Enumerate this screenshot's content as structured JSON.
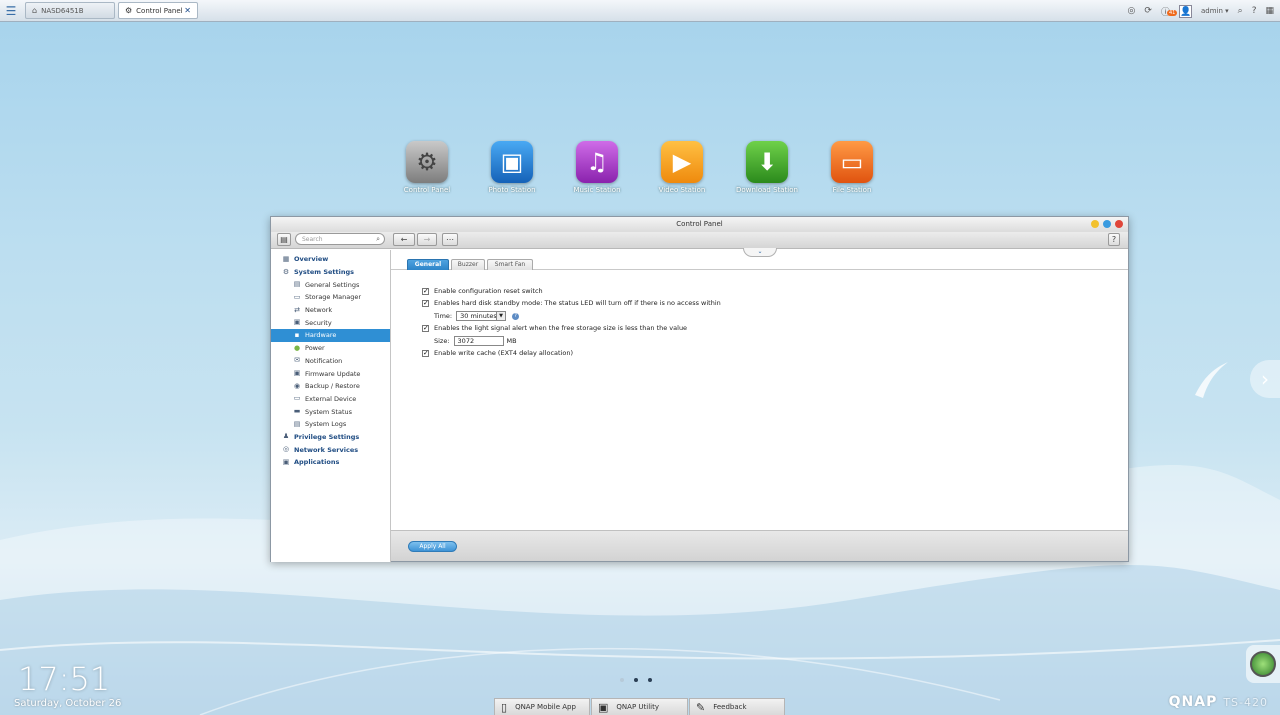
{
  "topbar": {
    "tabs": [
      {
        "label": "NASD6451B",
        "icon": "home-icon"
      },
      {
        "label": "Control Panel",
        "icon": "gear-icon"
      }
    ],
    "notification_count": "41",
    "user": "admin"
  },
  "apps": [
    {
      "label": "Control Panel",
      "icon": "gear-icon",
      "color": "#8e8e8e"
    },
    {
      "label": "Photo Station",
      "icon": "photo-icon",
      "color": "#1f7fd6"
    },
    {
      "label": "Music Station",
      "icon": "music-icon",
      "color": "#a63cc9"
    },
    {
      "label": "Video Station",
      "icon": "play-icon",
      "color": "#f39a1b"
    },
    {
      "label": "Download Station",
      "icon": "download-icon",
      "color": "#3e9f2a"
    },
    {
      "label": "File Station",
      "icon": "folder-icon",
      "color": "#ef6a1c"
    }
  ],
  "window": {
    "title": "Control Panel",
    "search_placeholder": "Search",
    "sidebar": [
      {
        "label": "Overview",
        "level": "top"
      },
      {
        "label": "System Settings",
        "level": "top"
      },
      {
        "label": "General Settings",
        "level": "sub"
      },
      {
        "label": "Storage Manager",
        "level": "sub"
      },
      {
        "label": "Network",
        "level": "sub"
      },
      {
        "label": "Security",
        "level": "sub"
      },
      {
        "label": "Hardware",
        "level": "sub",
        "selected": true
      },
      {
        "label": "Power",
        "level": "sub"
      },
      {
        "label": "Notification",
        "level": "sub"
      },
      {
        "label": "Firmware Update",
        "level": "sub"
      },
      {
        "label": "Backup / Restore",
        "level": "sub"
      },
      {
        "label": "External Device",
        "level": "sub"
      },
      {
        "label": "System Status",
        "level": "sub"
      },
      {
        "label": "System Logs",
        "level": "sub"
      },
      {
        "label": "Privilege Settings",
        "level": "top"
      },
      {
        "label": "Network Services",
        "level": "top"
      },
      {
        "label": "Applications",
        "level": "top"
      }
    ],
    "tabs": [
      "General",
      "Buzzer",
      "Smart Fan"
    ],
    "options": {
      "reset_switch": "Enable configuration reset switch",
      "standby": "Enables hard disk standby mode: The status LED will turn off if there is no access within",
      "time_label": "Time:",
      "time_value": "30 minutes",
      "light_alert": "Enables the light signal alert when the free storage size is less than the value",
      "size_label": "Size:",
      "size_value": "3072",
      "size_unit": "MB",
      "write_cache": "Enable write cache (EXT4 delay allocation)"
    },
    "apply_label": "Apply All"
  },
  "desktop": {
    "time": "17:51",
    "date": "Saturday, October 26",
    "dock": [
      "QNAP Mobile App",
      "QNAP Utility",
      "Feedback"
    ],
    "brand": "QNAP",
    "model": "TS-420"
  }
}
